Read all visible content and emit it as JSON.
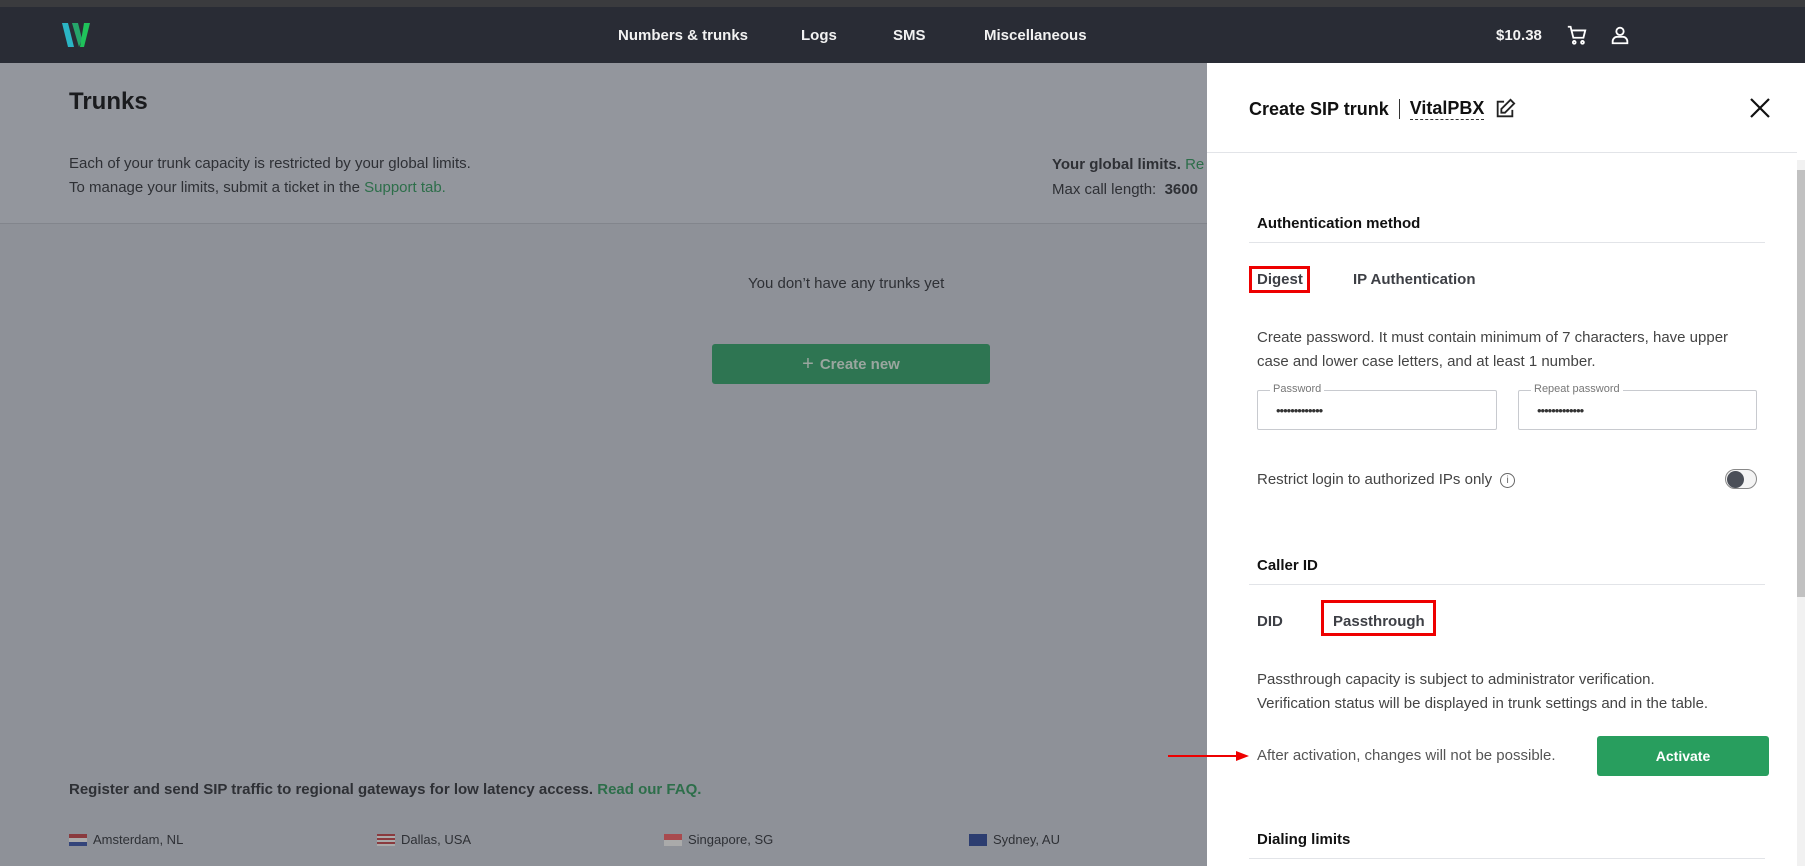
{
  "header": {
    "nav": [
      "Numbers & trunks",
      "Logs",
      "SMS",
      "Miscellaneous"
    ],
    "balance": "$10.38",
    "icons": [
      "logo",
      "cart-icon",
      "user-icon"
    ]
  },
  "page": {
    "title": "Trunks",
    "info_line1": "Each of your trunk capacity is restricted by your global limits.",
    "info_line2_prefix": "To manage your limits, submit a ticket in the ",
    "info_line2_link": "Support tab.",
    "global_limits_label": "Your global limits.",
    "global_limits_link": "Re",
    "max_call_label": "Max call length:",
    "max_call_value": "3600",
    "empty_state": "You don’t have any trunks yet",
    "create_new": "Create new",
    "gateways_text": "Register and send SIP traffic to regional gateways for low latency access.",
    "faq_link": "Read our FAQ.",
    "cities": [
      "Amsterdam, NL",
      "Dallas, USA",
      "Singapore, SG",
      "Sydney, AU"
    ]
  },
  "panel": {
    "title": "Create SIP trunk",
    "trunk_name": "VitalPBX",
    "auth": {
      "heading": "Authentication method",
      "tabs": [
        "Digest",
        "IP Authentication"
      ],
      "selected": "Digest",
      "description": "Create password. It must contain minimum of 7 characters, have upper case and lower case letters, and at least 1 number.",
      "password_label": "Password",
      "password_value": "•••••••••••••",
      "repeat_label": "Repeat password",
      "repeat_value": "•••••••••••••",
      "restrict_label": "Restrict login to authorized IPs only",
      "restrict_enabled": false
    },
    "caller_id": {
      "heading": "Caller ID",
      "tabs": [
        "DID",
        "Passthrough"
      ],
      "selected": "Passthrough",
      "note_line1": "Passthrough capacity is subject to administrator verification.",
      "note_line2": "Verification status will be displayed in trunk settings and in the table.",
      "warning": "After activation, changes will not be possible.",
      "activate": "Activate"
    },
    "dialing_limits": {
      "heading": "Dialing limits"
    }
  },
  "colors": {
    "accent": "#28a060",
    "highlight": "#e00000",
    "topbar": "#292c35"
  }
}
